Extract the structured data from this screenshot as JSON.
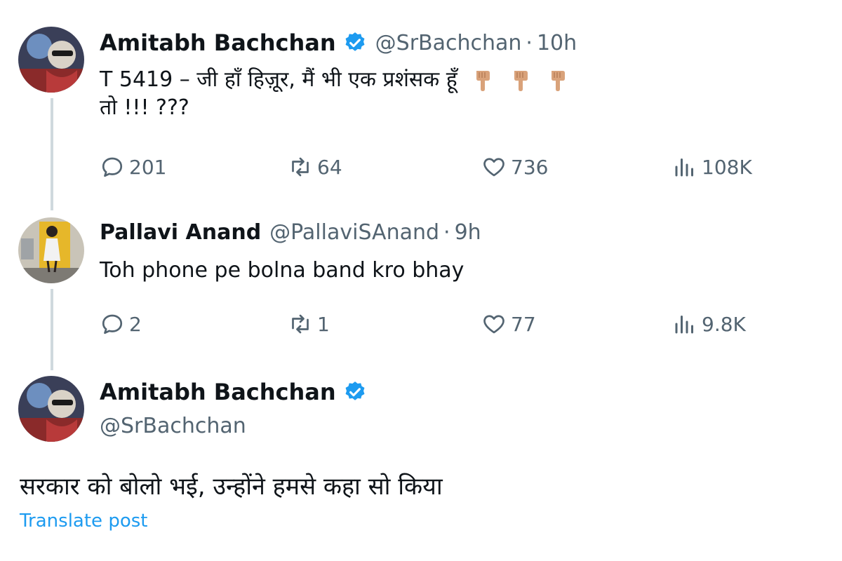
{
  "colors": {
    "accent": "#1d9bf0",
    "text_primary": "#0f1419",
    "text_secondary": "#536471",
    "thread_line": "#cfd9de"
  },
  "tweet1": {
    "display_name": "Amitabh Bachchan",
    "verified": true,
    "handle": "@SrBachchan",
    "separator": "·",
    "time": "10h",
    "text_line1": "T 5419 – जी हाँ हिज़ूर, मैं भी एक प्रशंसक हूँ",
    "emoji": "pointing-down-hand-emoji",
    "emoji_count": 3,
    "text_line2": "तो !!! ???",
    "stats": {
      "replies": "201",
      "reposts": "64",
      "likes": "736",
      "views": "108K"
    }
  },
  "tweet2": {
    "display_name": "Pallavi Anand",
    "handle": "@PallaviSAnand",
    "separator": "·",
    "time": "9h",
    "text": "Toh phone pe bolna band kro bhay",
    "stats": {
      "replies": "2",
      "reposts": "1",
      "likes": "77",
      "views": "9.8K"
    }
  },
  "tweet3": {
    "display_name": "Amitabh Bachchan",
    "verified": true,
    "handle": "@SrBachchan",
    "text": "सरकार को बोलो भई, उन्होंने हमसे कहा सो किया",
    "translate_label": "Translate post"
  }
}
